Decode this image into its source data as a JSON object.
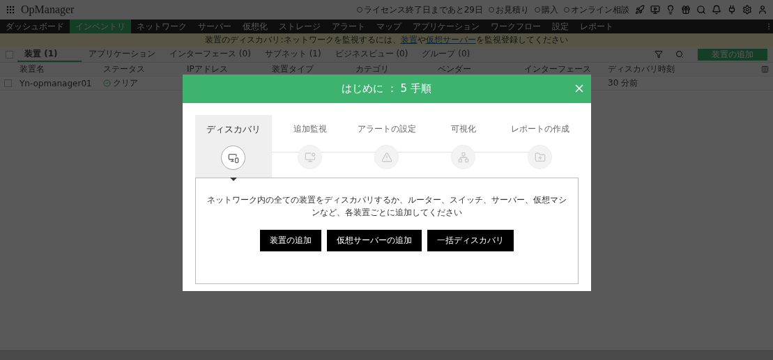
{
  "app": {
    "title": "OpManager"
  },
  "header_links": [
    "ライセンス終了日まであと29日",
    "お見積り",
    "購入",
    "オンライン相談"
  ],
  "nav": [
    {
      "label": "ダッシュボード",
      "selected": false
    },
    {
      "label": "インベントリ",
      "selected": true
    },
    {
      "label": "ネットワーク",
      "selected": false
    },
    {
      "label": "サーバー",
      "selected": false
    },
    {
      "label": "仮想化",
      "selected": false
    },
    {
      "label": "ストレージ",
      "selected": false
    },
    {
      "label": "アラート",
      "selected": false
    },
    {
      "label": "マップ",
      "selected": false
    },
    {
      "label": "アプリケーション",
      "selected": false
    },
    {
      "label": "ワークフロー",
      "selected": false
    },
    {
      "label": "設定",
      "selected": false
    },
    {
      "label": "レポート",
      "selected": false
    }
  ],
  "banner": [
    {
      "kind": "text",
      "text": "装置のディスカバリ:ネットワークを監視するには、"
    },
    {
      "kind": "link",
      "text": "装置"
    },
    {
      "kind": "text",
      "text": "や"
    },
    {
      "kind": "link",
      "text": "仮想サーバー"
    },
    {
      "kind": "text",
      "text": "を監視登録してください"
    }
  ],
  "tabs": [
    {
      "label": "装置",
      "count": "(1)",
      "selected": true
    },
    {
      "label": "アプリケーション",
      "selected": false
    },
    {
      "label": "インターフェース",
      "count": "(0)",
      "selected": false
    },
    {
      "label": "サブネット",
      "count": "(1)",
      "selected": false
    },
    {
      "label": "ビジネスビュー",
      "count": "(0)",
      "selected": false
    },
    {
      "label": "グループ",
      "count": "(0)",
      "selected": false
    }
  ],
  "select_all": {
    "checked": false
  },
  "add_button": "装置の追加",
  "table": {
    "columns": [
      "装置名",
      "ステータス",
      "IPアドレス",
      "装置タイプ",
      "カテゴリ",
      "ベンダー",
      "インターフェース",
      "ディスカバリ時刻"
    ],
    "rows": [
      {
        "cells": [
          "Yn-opmanager01",
          "クリア",
          "",
          "",
          "",
          "",
          "",
          "30 分前"
        ],
        "checked": false
      }
    ]
  },
  "dialog": {
    "title": "はじめに ： 5 手順",
    "steps": [
      {
        "label": "ディスカバリ",
        "kind": "discovery",
        "selected": true
      },
      {
        "label": "追加監視",
        "kind": "monitor",
        "selected": false
      },
      {
        "label": "アラートの設定",
        "kind": "alert",
        "selected": false
      },
      {
        "label": "可視化",
        "kind": "map",
        "selected": false
      },
      {
        "label": "レポートの作成",
        "kind": "report",
        "selected": false
      }
    ],
    "description": "ネットワーク内の全ての装置をディスカバリするか、ルーター、スイッチ、サーバー、仮想マシンなど、各装置ごとに追加してください",
    "buttons": [
      "装置の追加",
      "仮想サーバーの追加",
      "一括ディスカバリ"
    ]
  }
}
